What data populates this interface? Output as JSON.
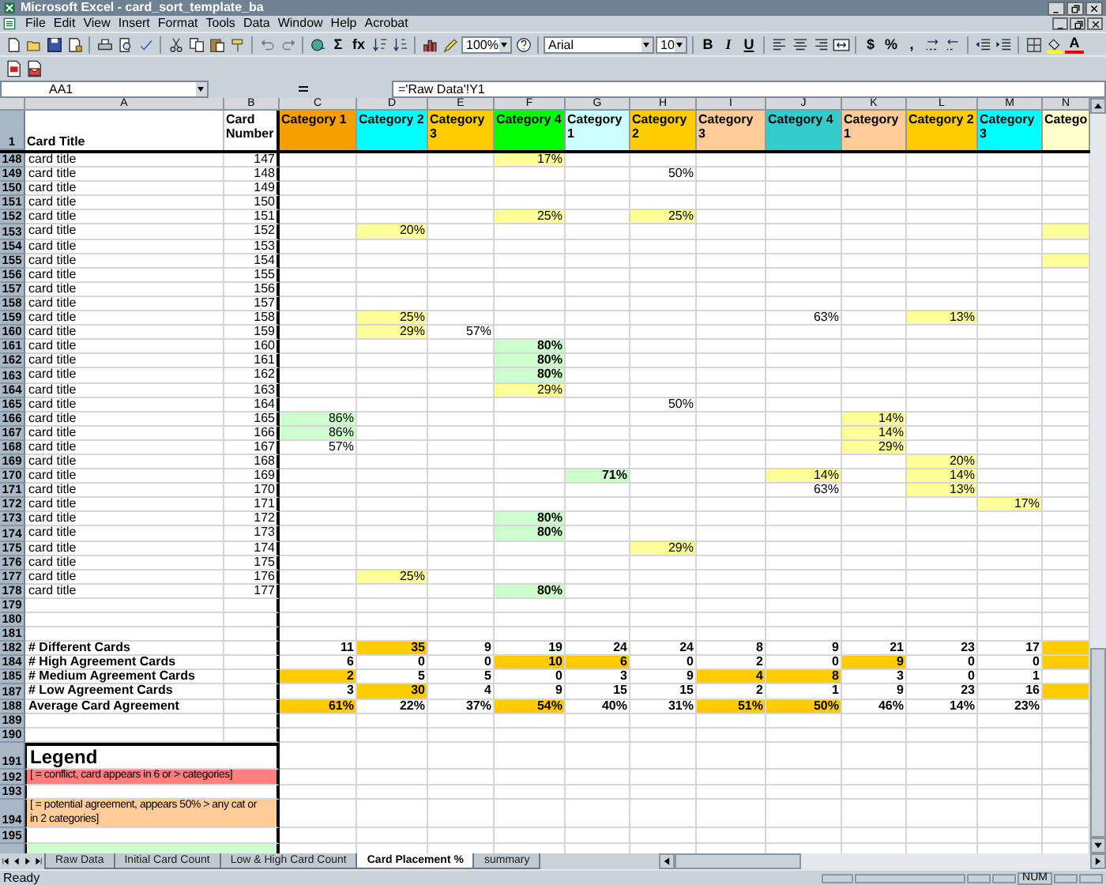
{
  "window": {
    "title": "Microsoft Excel - card_sort_template_ba"
  },
  "menu": [
    "File",
    "Edit",
    "View",
    "Insert",
    "Format",
    "Tools",
    "Data",
    "Window",
    "Help",
    "Acrobat"
  ],
  "toolbar": [
    {
      "kind": "new"
    },
    {
      "kind": "open"
    },
    {
      "kind": "save"
    },
    {
      "kind": "permission"
    },
    {
      "kind": "separator"
    },
    {
      "kind": "print"
    },
    {
      "kind": "preview"
    },
    {
      "kind": "spell"
    },
    {
      "kind": "separator"
    },
    {
      "kind": "cut"
    },
    {
      "kind": "copy"
    },
    {
      "kind": "paste"
    },
    {
      "kind": "painter"
    },
    {
      "kind": "separator"
    },
    {
      "kind": "undo"
    },
    {
      "kind": "redo"
    },
    {
      "kind": "separator"
    },
    {
      "kind": "hyperlink"
    },
    {
      "kind": "autosum",
      "glyph": "Σ"
    },
    {
      "kind": "function",
      "glyph": "fx"
    },
    {
      "kind": "sort-asc"
    },
    {
      "kind": "sort-desc"
    },
    {
      "kind": "separator"
    },
    {
      "kind": "chart"
    },
    {
      "kind": "drawing"
    },
    {
      "kind": "zoom-select",
      "value": "100%"
    },
    {
      "kind": "help"
    },
    {
      "kind": "separator"
    },
    {
      "kind": "font-select",
      "value": "Arial"
    },
    {
      "kind": "size-select",
      "value": "10"
    },
    {
      "kind": "separator"
    },
    {
      "kind": "bold",
      "glyph": "B"
    },
    {
      "kind": "italic",
      "glyph": "I"
    },
    {
      "kind": "underline",
      "glyph": "U"
    },
    {
      "kind": "separator"
    },
    {
      "kind": "align-left"
    },
    {
      "kind": "align-center"
    },
    {
      "kind": "align-right"
    },
    {
      "kind": "merge"
    },
    {
      "kind": "separator"
    },
    {
      "kind": "currency",
      "glyph": "$"
    },
    {
      "kind": "percent",
      "glyph": "%"
    },
    {
      "kind": "comma",
      "glyph": ","
    },
    {
      "kind": "inc-decimal"
    },
    {
      "kind": "dec-decimal"
    },
    {
      "kind": "separator"
    },
    {
      "kind": "outdent"
    },
    {
      "kind": "indent"
    },
    {
      "kind": "separator"
    },
    {
      "kind": "borders"
    },
    {
      "kind": "fill-color"
    },
    {
      "kind": "font-color",
      "glyph": "A"
    }
  ],
  "toolbar2": [
    {
      "kind": "pdf"
    },
    {
      "kind": "pdf-mail"
    }
  ],
  "formula_bar": {
    "name_box": "AA1",
    "formula": "='Raw Data'!Y1"
  },
  "sheet": {
    "column_letters": [
      "A",
      "B",
      "C",
      "D",
      "E",
      "F",
      "G",
      "H",
      "I",
      "J",
      "K",
      "L",
      "M",
      "N"
    ],
    "header_row": {
      "number": "1",
      "title": "Card Title",
      "card_number": "Card Number"
    },
    "categories": [
      {
        "label": "Category 1",
        "color": "#f5a000"
      },
      {
        "label": "Category 2",
        "color": "#00ffff"
      },
      {
        "label": "Category 3",
        "color": "#ffcc00"
      },
      {
        "label": "Category 4",
        "color": "#00ff00"
      },
      {
        "label": "Category 1",
        "color": "#ccffff"
      },
      {
        "label": "Category 2",
        "color": "#ffcc00"
      },
      {
        "label": "Category 3",
        "color": "#ffcc99"
      },
      {
        "label": "Category 4",
        "color": "#33cccc"
      },
      {
        "label": "Category 1",
        "color": "#ffcc99"
      },
      {
        "label": "Category 2",
        "color": "#ffcc00"
      },
      {
        "label": "Category 3",
        "color": "#00ffff"
      },
      {
        "label": "Catego",
        "color": "#ffffcc"
      }
    ],
    "rows": [
      {
        "number": "148",
        "kind": "card",
        "title": "card title",
        "card_number": "147",
        "cells": [
          {},
          {},
          {},
          {
            "text": "17%",
            "color": "#ffff99"
          },
          {},
          {},
          {},
          {},
          {},
          {},
          {},
          {}
        ]
      },
      {
        "number": "149",
        "kind": "card",
        "title": "card title",
        "card_number": "148",
        "cells": [
          {},
          {},
          {},
          {},
          {},
          {
            "text": "50%"
          },
          {},
          {},
          {},
          {},
          {},
          {}
        ]
      },
      {
        "number": "150",
        "kind": "card",
        "title": "card title",
        "card_number": "149",
        "cells": [
          {},
          {},
          {},
          {},
          {},
          {},
          {},
          {},
          {},
          {},
          {},
          {}
        ]
      },
      {
        "number": "151",
        "kind": "card",
        "title": "card title",
        "card_number": "150",
        "cells": [
          {},
          {},
          {},
          {},
          {},
          {},
          {},
          {},
          {},
          {},
          {},
          {}
        ]
      },
      {
        "number": "152",
        "kind": "card",
        "title": "card title",
        "card_number": "151",
        "cells": [
          {},
          {},
          {},
          {
            "text": "25%",
            "color": "#ffff99"
          },
          {},
          {
            "text": "25%",
            "color": "#ffff99"
          },
          {},
          {},
          {},
          {},
          {},
          {}
        ]
      },
      {
        "number": "153",
        "kind": "card",
        "title": "card title",
        "card_number": "152",
        "cells": [
          {},
          {
            "text": "20%",
            "color": "#ffff99"
          },
          {},
          {},
          {},
          {},
          {},
          {},
          {},
          {},
          {},
          {
            "color": "#ffff99"
          }
        ]
      },
      {
        "number": "154",
        "kind": "card",
        "title": "card title",
        "card_number": "153",
        "cells": [
          {},
          {},
          {},
          {},
          {},
          {},
          {},
          {},
          {},
          {},
          {},
          {}
        ]
      },
      {
        "number": "155",
        "kind": "card",
        "title": "card title",
        "card_number": "154",
        "cells": [
          {},
          {},
          {},
          {},
          {},
          {},
          {},
          {},
          {},
          {},
          {},
          {
            "color": "#ffff99"
          }
        ]
      },
      {
        "number": "156",
        "kind": "card",
        "title": "card title",
        "card_number": "155",
        "cells": [
          {},
          {},
          {},
          {},
          {},
          {},
          {},
          {},
          {},
          {},
          {},
          {}
        ]
      },
      {
        "number": "157",
        "kind": "card",
        "title": "card title",
        "card_number": "156",
        "cells": [
          {},
          {},
          {},
          {},
          {},
          {},
          {},
          {},
          {},
          {},
          {},
          {}
        ]
      },
      {
        "number": "158",
        "kind": "card",
        "title": "card title",
        "card_number": "157",
        "cells": [
          {},
          {},
          {},
          {},
          {},
          {},
          {},
          {},
          {},
          {},
          {},
          {}
        ]
      },
      {
        "number": "159",
        "kind": "card",
        "title": "card title",
        "card_number": "158",
        "cells": [
          {},
          {
            "text": "25%",
            "color": "#ffff99"
          },
          {},
          {},
          {},
          {},
          {},
          {
            "text": "63%"
          },
          {},
          {
            "text": "13%",
            "color": "#ffff99"
          },
          {},
          {}
        ]
      },
      {
        "number": "160",
        "kind": "card",
        "title": "card title",
        "card_number": "159",
        "cells": [
          {},
          {
            "text": "29%",
            "color": "#ffff99"
          },
          {
            "text": "57%"
          },
          {},
          {},
          {},
          {},
          {},
          {},
          {},
          {},
          {}
        ]
      },
      {
        "number": "161",
        "kind": "card",
        "title": "card title",
        "card_number": "160",
        "cells": [
          {},
          {},
          {},
          {
            "text": "80%",
            "color": "#ccffcc",
            "bold": true
          },
          {},
          {},
          {},
          {},
          {},
          {},
          {},
          {}
        ]
      },
      {
        "number": "162",
        "kind": "card",
        "title": "card title",
        "card_number": "161",
        "cells": [
          {},
          {},
          {},
          {
            "text": "80%",
            "color": "#ccffcc",
            "bold": true
          },
          {},
          {},
          {},
          {},
          {},
          {},
          {},
          {}
        ]
      },
      {
        "number": "163",
        "kind": "card",
        "title": "card title",
        "card_number": "162",
        "cells": [
          {},
          {},
          {},
          {
            "text": "80%",
            "color": "#ccffcc",
            "bold": true
          },
          {},
          {},
          {},
          {},
          {},
          {},
          {},
          {}
        ]
      },
      {
        "number": "164",
        "kind": "card",
        "title": "card title",
        "card_number": "163",
        "cells": [
          {},
          {},
          {},
          {
            "text": "29%",
            "color": "#ffff99"
          },
          {},
          {},
          {},
          {},
          {},
          {},
          {},
          {}
        ]
      },
      {
        "number": "165",
        "kind": "card",
        "title": "card title",
        "card_number": "164",
        "cells": [
          {},
          {},
          {},
          {},
          {},
          {
            "text": "50%"
          },
          {},
          {},
          {},
          {},
          {},
          {}
        ]
      },
      {
        "number": "166",
        "kind": "card",
        "title": "card title",
        "card_number": "165",
        "cells": [
          {
            "text": "86%",
            "color": "#ccffcc"
          },
          {},
          {},
          {},
          {},
          {},
          {},
          {},
          {
            "text": "14%",
            "color": "#ffff99"
          },
          {},
          {},
          {}
        ]
      },
      {
        "number": "167",
        "kind": "card",
        "title": "card title",
        "card_number": "166",
        "cells": [
          {
            "text": "86%",
            "color": "#ccffcc"
          },
          {},
          {},
          {},
          {},
          {},
          {},
          {},
          {
            "text": "14%",
            "color": "#ffff99"
          },
          {},
          {},
          {}
        ]
      },
      {
        "number": "168",
        "kind": "card",
        "title": "card title",
        "card_number": "167",
        "cells": [
          {
            "text": "57%"
          },
          {},
          {},
          {},
          {},
          {},
          {},
          {},
          {
            "text": "29%",
            "color": "#ffff99"
          },
          {},
          {},
          {}
        ]
      },
      {
        "number": "169",
        "kind": "card",
        "title": "card title",
        "card_number": "168",
        "cells": [
          {},
          {},
          {},
          {},
          {},
          {},
          {},
          {},
          {},
          {
            "text": "20%",
            "color": "#ffff99"
          },
          {},
          {}
        ]
      },
      {
        "number": "170",
        "kind": "card",
        "title": "card title",
        "card_number": "169",
        "cells": [
          {},
          {},
          {},
          {},
          {
            "text": "71%",
            "color": "#ccffcc",
            "bold": true
          },
          {},
          {},
          {
            "text": "14%",
            "color": "#ffff99"
          },
          {},
          {
            "text": "14%",
            "color": "#ffff99"
          },
          {},
          {}
        ]
      },
      {
        "number": "171",
        "kind": "card",
        "title": "card title",
        "card_number": "170",
        "cells": [
          {},
          {},
          {},
          {},
          {},
          {},
          {},
          {
            "text": "63%"
          },
          {},
          {
            "text": "13%",
            "color": "#ffff99"
          },
          {},
          {}
        ]
      },
      {
        "number": "172",
        "kind": "card",
        "title": "card title",
        "card_number": "171",
        "cells": [
          {},
          {},
          {},
          {},
          {},
          {},
          {},
          {},
          {},
          {},
          {
            "text": "17%",
            "color": "#ffff99"
          },
          {}
        ]
      },
      {
        "number": "173",
        "kind": "card",
        "title": "card title",
        "card_number": "172",
        "cells": [
          {},
          {},
          {},
          {
            "text": "80%",
            "color": "#ccffcc",
            "bold": true
          },
          {},
          {},
          {},
          {},
          {},
          {},
          {},
          {}
        ]
      },
      {
        "number": "174",
        "kind": "card",
        "title": "card title",
        "card_number": "173",
        "cells": [
          {},
          {},
          {},
          {
            "text": "80%",
            "color": "#ccffcc",
            "bold": true
          },
          {},
          {},
          {},
          {},
          {},
          {},
          {},
          {}
        ]
      },
      {
        "number": "175",
        "kind": "card",
        "title": "card title",
        "card_number": "174",
        "cells": [
          {},
          {},
          {},
          {},
          {},
          {
            "text": "29%",
            "color": "#ffff99"
          },
          {},
          {},
          {},
          {},
          {},
          {}
        ]
      },
      {
        "number": "176",
        "kind": "card",
        "title": "card title",
        "card_number": "175",
        "cells": [
          {},
          {},
          {},
          {},
          {},
          {},
          {},
          {},
          {},
          {},
          {},
          {}
        ]
      },
      {
        "number": "177",
        "kind": "card",
        "title": "card title",
        "card_number": "176",
        "cells": [
          {},
          {
            "text": "25%",
            "color": "#ffff99"
          },
          {},
          {},
          {},
          {},
          {},
          {},
          {},
          {},
          {},
          {}
        ]
      },
      {
        "number": "178",
        "kind": "card",
        "title": "card title",
        "card_number": "177",
        "cells": [
          {},
          {},
          {},
          {
            "text": "80%",
            "color": "#ccffcc",
            "bold": true
          },
          {},
          {},
          {},
          {},
          {},
          {},
          {},
          {}
        ]
      },
      {
        "number": "179",
        "kind": "blank"
      },
      {
        "number": "180",
        "kind": "blank"
      },
      {
        "number": "181",
        "kind": "blank"
      },
      {
        "number": "182",
        "kind": "summary",
        "label": "# Different Cards",
        "cells": [
          {
            "text": "11"
          },
          {
            "text": "35",
            "color": "#ffcc00"
          },
          {
            "text": "9"
          },
          {
            "text": "19"
          },
          {
            "text": "24"
          },
          {
            "text": "24"
          },
          {
            "text": "8"
          },
          {
            "text": "9"
          },
          {
            "text": "21"
          },
          {
            "text": "23"
          },
          {
            "text": "17"
          },
          {
            "color": "#ffcc00"
          }
        ]
      },
      {
        "number": "184",
        "kind": "summary",
        "label": "# High Agreement Cards",
        "cells": [
          {
            "text": "6"
          },
          {
            "text": "0"
          },
          {
            "text": "0"
          },
          {
            "text": "10",
            "color": "#ffcc00"
          },
          {
            "text": "6",
            "color": "#ffcc00"
          },
          {
            "text": "0"
          },
          {
            "text": "2"
          },
          {
            "text": "0"
          },
          {
            "text": "9",
            "color": "#ffcc00"
          },
          {
            "text": "0"
          },
          {
            "text": "0"
          },
          {
            "color": "#ffcc00"
          }
        ]
      },
      {
        "number": "185",
        "kind": "summary",
        "label": "# Medium Agreement Cards",
        "cells": [
          {
            "text": "2",
            "color": "#ffcc00"
          },
          {
            "text": "5"
          },
          {
            "text": "5"
          },
          {
            "text": "0"
          },
          {
            "text": "3"
          },
          {
            "text": "9"
          },
          {
            "text": "4",
            "color": "#ffcc00"
          },
          {
            "text": "8",
            "color": "#ffcc00"
          },
          {
            "text": "3"
          },
          {
            "text": "0"
          },
          {
            "text": "1"
          },
          {}
        ]
      },
      {
        "number": "187",
        "kind": "summary",
        "label": "# Low Agreement Cards",
        "cells": [
          {
            "text": "3"
          },
          {
            "text": "30",
            "color": "#ffcc00"
          },
          {
            "text": "4"
          },
          {
            "text": "9"
          },
          {
            "text": "15"
          },
          {
            "text": "15"
          },
          {
            "text": "2"
          },
          {
            "text": "1"
          },
          {
            "text": "9"
          },
          {
            "text": "23"
          },
          {
            "text": "16"
          },
          {
            "color": "#ffcc00"
          }
        ]
      },
      {
        "number": "188",
        "kind": "summary",
        "label": "Average Card Agreement",
        "cells": [
          {
            "text": "61%",
            "color": "#ffcc00"
          },
          {
            "text": "22%"
          },
          {
            "text": "37%"
          },
          {
            "text": "54%",
            "color": "#ffcc00"
          },
          {
            "text": "40%"
          },
          {
            "text": "31%"
          },
          {
            "text": "51%",
            "color": "#ffcc00"
          },
          {
            "text": "50%",
            "color": "#ffcc00"
          },
          {
            "text": "46%"
          },
          {
            "text": "14%"
          },
          {
            "text": "23%"
          },
          {}
        ]
      },
      {
        "number": "189",
        "kind": "blank"
      },
      {
        "number": "190",
        "kind": "blank"
      },
      {
        "number": "191",
        "kind": "legend-title",
        "text": "Legend"
      },
      {
        "number": "192",
        "kind": "legend-item",
        "text": "[ = conflict, card appears in 6 or > categories]",
        "color": "#ff7f7f"
      },
      {
        "number": "193",
        "kind": "legend-gap"
      },
      {
        "number": "194",
        "kind": "legend-item",
        "text": "[ = potential agreement, appears 50% > any cat or in 2 categories]",
        "color": "#ffcc99"
      },
      {
        "number": "195",
        "kind": "legend-gap"
      },
      {
        "kind": "legend-item",
        "color": "#ccffcc"
      }
    ]
  },
  "sheet_tabs": [
    {
      "label": "Raw Data",
      "selected": false
    },
    {
      "label": "Initial Card Count",
      "selected": false
    },
    {
      "label": "Low & High Card Count",
      "selected": false
    },
    {
      "label": "Card Placement %",
      "selected": true
    },
    {
      "label": "summary",
      "selected": false
    }
  ],
  "status_bar": {
    "mode": "Ready",
    "indicators": [
      "NUM"
    ]
  }
}
